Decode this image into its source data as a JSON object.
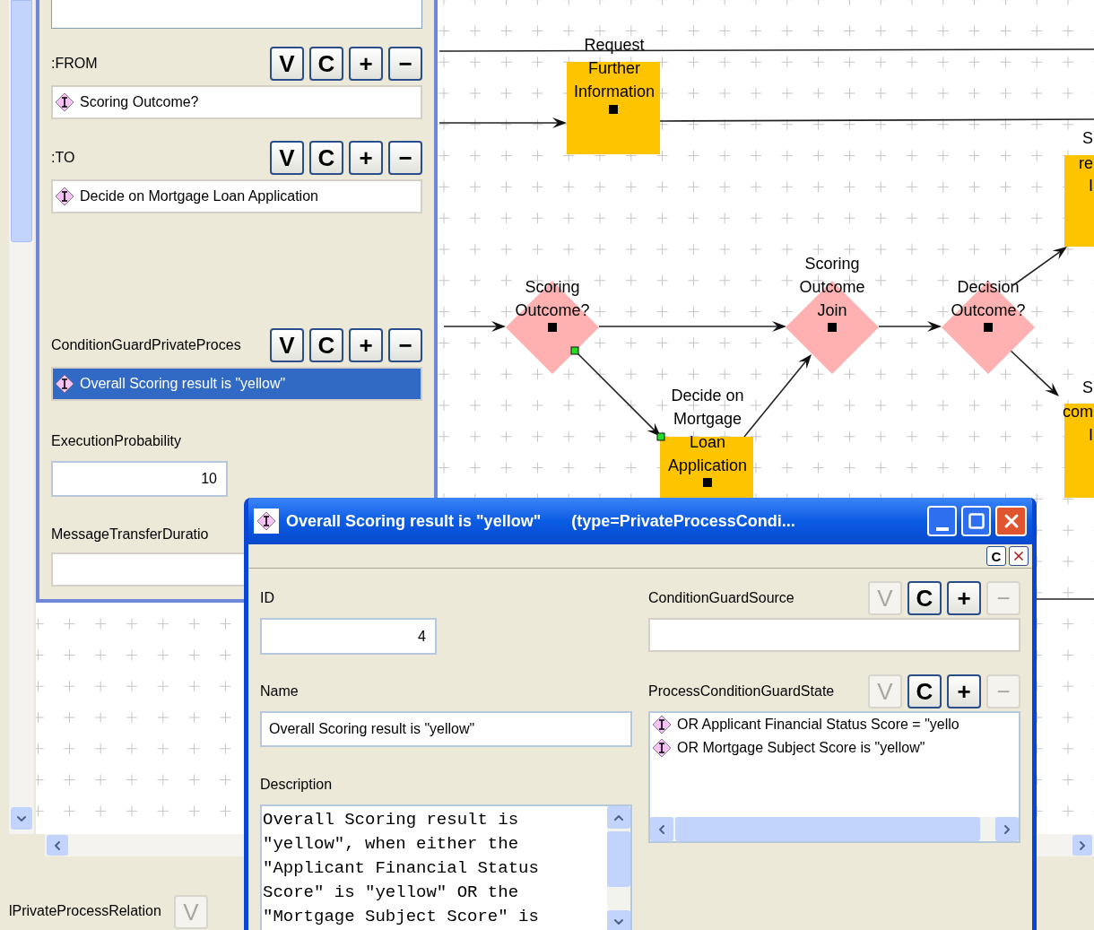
{
  "left_panel": {
    "references": [
      {
        "label": ":FROM",
        "buttons": [
          {
            "label": "V",
            "disabled": false
          },
          {
            "label": "C",
            "disabled": false
          },
          {
            "label": "+",
            "disabled": false
          },
          {
            "label": "−",
            "disabled": false
          }
        ],
        "items": [
          {
            "text": "Scoring Outcome?",
            "selected": false
          }
        ]
      },
      {
        "label": ":TO",
        "buttons": [
          {
            "label": "V",
            "disabled": false
          },
          {
            "label": "C",
            "disabled": false
          },
          {
            "label": "+",
            "disabled": false
          },
          {
            "label": "−",
            "disabled": false
          }
        ],
        "items": [
          {
            "text": "Decide on Mortgage Loan Application",
            "selected": false
          }
        ]
      },
      {
        "label": "ConditionGuardPrivateProces",
        "buttons": [
          {
            "label": "V",
            "disabled": false
          },
          {
            "label": "C",
            "disabled": false
          },
          {
            "label": "+",
            "disabled": false
          },
          {
            "label": "−",
            "disabled": false
          }
        ],
        "items": [
          {
            "text": "Overall Scoring result is \"yellow\"",
            "selected": true
          }
        ]
      }
    ],
    "execution_probability": {
      "label": "ExecutionProbability",
      "value": "10"
    },
    "message_transfer_duration": {
      "label": "MessageTransferDuratio"
    }
  },
  "diagram": {
    "nodes": [
      {
        "kind": "task",
        "label": [
          "Request",
          "Further",
          "Information"
        ]
      },
      {
        "kind": "task",
        "label": [
          "S",
          "re",
          "I"
        ]
      },
      {
        "kind": "gateway",
        "label": [
          "Scoring",
          "Outcome?"
        ]
      },
      {
        "kind": "gateway",
        "label": [
          "Scoring",
          "Outcome",
          "Join"
        ]
      },
      {
        "kind": "gateway",
        "label": [
          "Decision",
          "Outcome?"
        ]
      },
      {
        "kind": "task",
        "label": [
          "Decide on",
          "Mortgage",
          "Loan",
          "Application"
        ]
      },
      {
        "kind": "task",
        "label": [
          "S",
          "com",
          "I"
        ]
      }
    ]
  },
  "bottom_bar": {
    "label": "lPrivateProcessRelation",
    "buttons": [
      {
        "label": "V",
        "disabled": true
      }
    ]
  },
  "dialog": {
    "title": "Overall Scoring result is \"yellow\"",
    "type": "(type=PrivateProcessCondi...",
    "toolbar_buttons": [
      "C"
    ],
    "id": {
      "label": "ID",
      "value": "4"
    },
    "name": {
      "label": "Name",
      "value": "Overall Scoring result is \"yellow\""
    },
    "description": {
      "label": "Description",
      "value": "Overall Scoring result is \"yellow\", when either the \"Applicant Financial Status Score\" is \"yellow\" OR the \"Mortgage Subject Score\" is"
    },
    "condition_guard_source": {
      "label": "ConditionGuardSource",
      "buttons": [
        {
          "label": "V",
          "disabled": true
        },
        {
          "label": "C",
          "disabled": false
        },
        {
          "label": "+",
          "disabled": false
        },
        {
          "label": "−",
          "disabled": true
        }
      ]
    },
    "process_condition_guard_state": {
      "label": "ProcessConditionGuardState",
      "buttons": [
        {
          "label": "V",
          "disabled": true
        },
        {
          "label": "C",
          "disabled": false
        },
        {
          "label": "+",
          "disabled": false
        },
        {
          "label": "−",
          "disabled": true
        }
      ],
      "items": [
        {
          "text": "OR Applicant Financial Status Score = \"yello",
          "selected": false
        },
        {
          "text": "OR Mortgage Subject Score is \"yellow\"",
          "selected": false
        }
      ]
    }
  }
}
